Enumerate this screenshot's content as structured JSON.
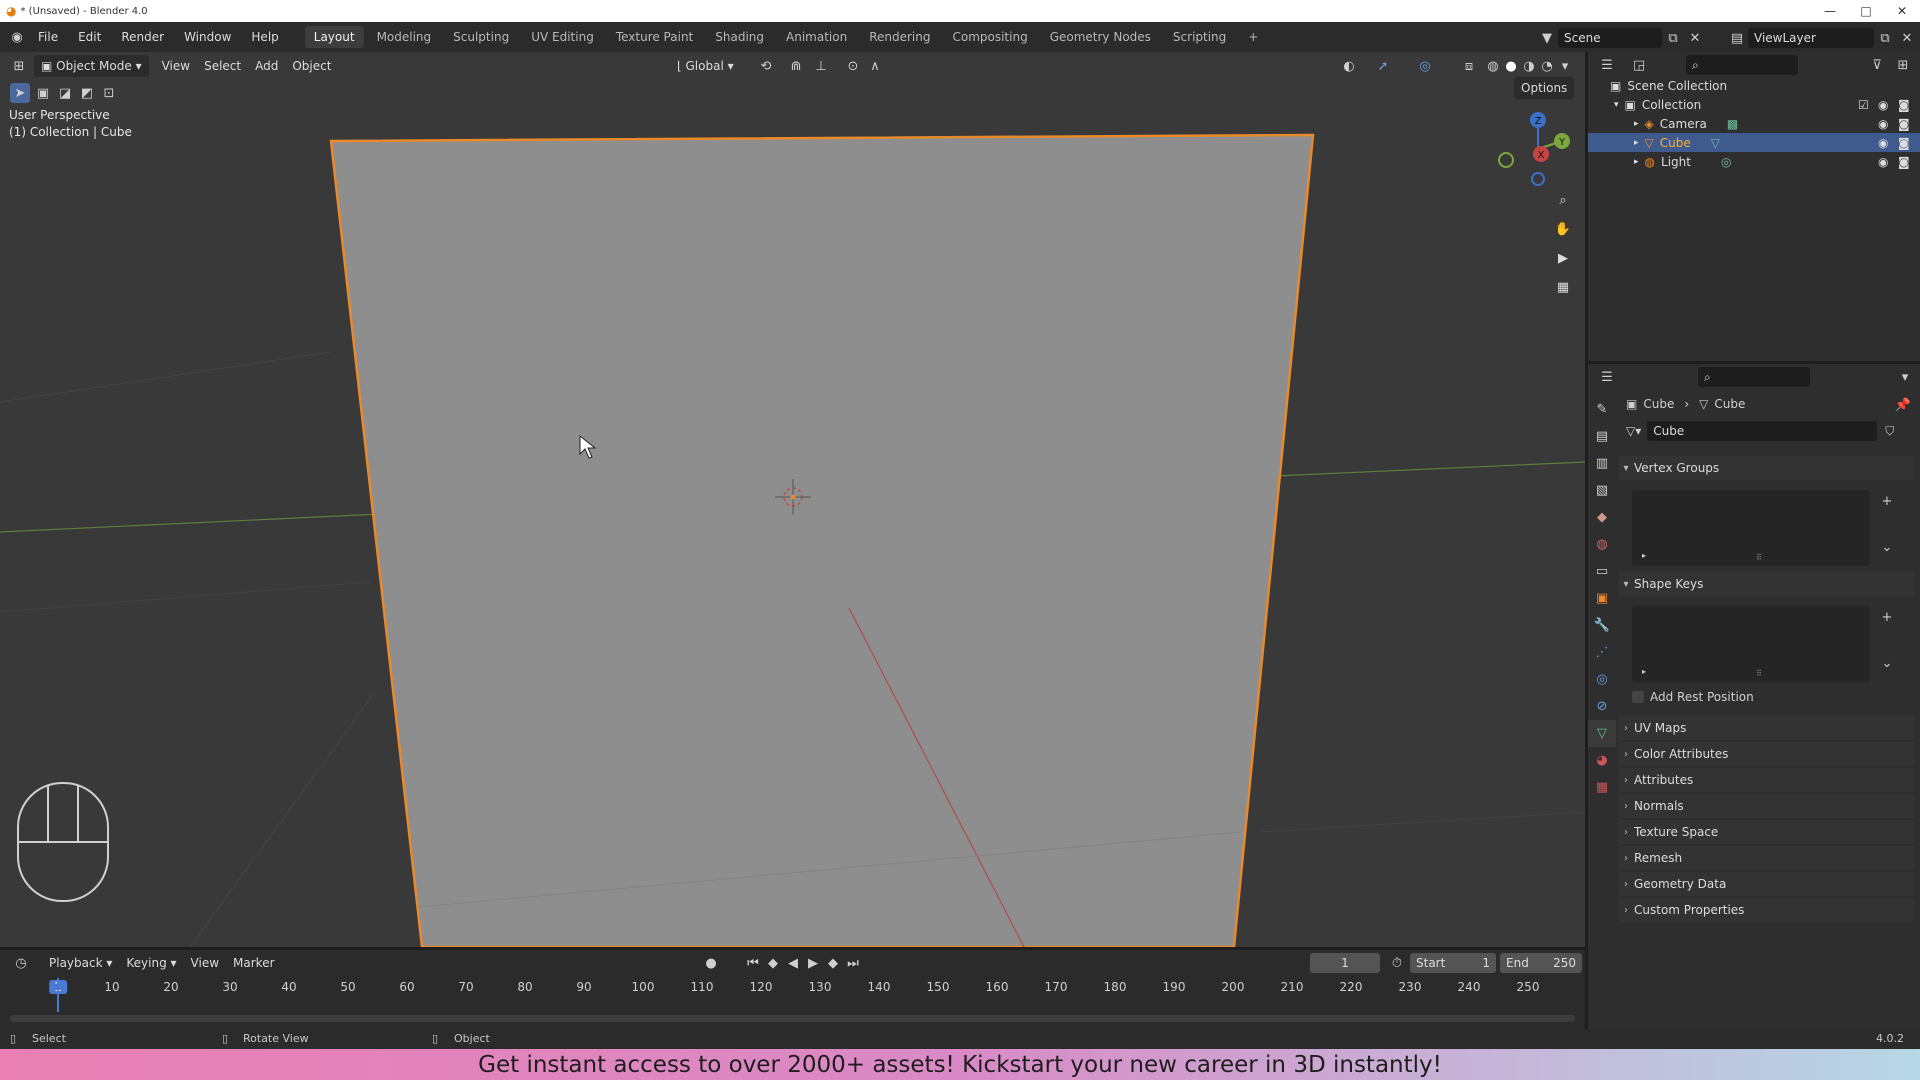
{
  "window": {
    "title": "* (Unsaved) - Blender 4.0",
    "minimize": "—",
    "maximize": "□",
    "close": "✕"
  },
  "menu": [
    "File",
    "Edit",
    "Render",
    "Window",
    "Help"
  ],
  "workspaces": [
    "Layout",
    "Modeling",
    "Sculpting",
    "UV Editing",
    "Texture Paint",
    "Shading",
    "Animation",
    "Rendering",
    "Compositing",
    "Geometry Nodes",
    "Scripting"
  ],
  "workspace_add": "+",
  "scene": {
    "name": "Scene",
    "view_layer": "ViewLayer"
  },
  "viewport": {
    "mode": "Object Mode",
    "menus": [
      "View",
      "Select",
      "Add",
      "Object"
    ],
    "transform_orientation": "Global",
    "options": "Options",
    "perspective_label": "User Perspective",
    "collection_label": "(1) Collection | Cube",
    "gizmo_axes": {
      "z": "Z",
      "y": "Y",
      "x": "X"
    }
  },
  "outliner": {
    "root": "Scene Collection",
    "collection": "Collection",
    "items": [
      {
        "name": "Camera",
        "selected": false
      },
      {
        "name": "Cube",
        "selected": true
      },
      {
        "name": "Light",
        "selected": false
      }
    ]
  },
  "properties": {
    "breadcrumb": [
      "Cube",
      "Cube"
    ],
    "mesh_name": "Cube",
    "panels_open": [
      "Vertex Groups",
      "Shape Keys"
    ],
    "add_rest_position": "Add Rest Position",
    "panels_closed": [
      "UV Maps",
      "Color Attributes",
      "Attributes",
      "Normals",
      "Texture Space",
      "Remesh",
      "Geometry Data",
      "Custom Properties"
    ]
  },
  "timeline": {
    "menus": [
      "Playback",
      "Keying",
      "View",
      "Marker"
    ],
    "current_frame": "1",
    "start_label": "Start",
    "start": "1",
    "end_label": "End",
    "end": "250",
    "ticks": [
      "1",
      "10",
      "20",
      "30",
      "40",
      "50",
      "60",
      "70",
      "80",
      "90",
      "100",
      "110",
      "120",
      "130",
      "140",
      "150",
      "160",
      "170",
      "180",
      "190",
      "200",
      "210",
      "220",
      "230",
      "240",
      "250"
    ]
  },
  "status": {
    "left": "Select",
    "middle": "Rotate View",
    "right": "Object",
    "version": "4.0.2"
  },
  "banner": "Get instant access to over 2000+ assets! Kickstart your new career in 3D instantly!",
  "colors": {
    "accent": "#e8892b",
    "selected": "#3f5a8c",
    "viewport": "#393939"
  }
}
